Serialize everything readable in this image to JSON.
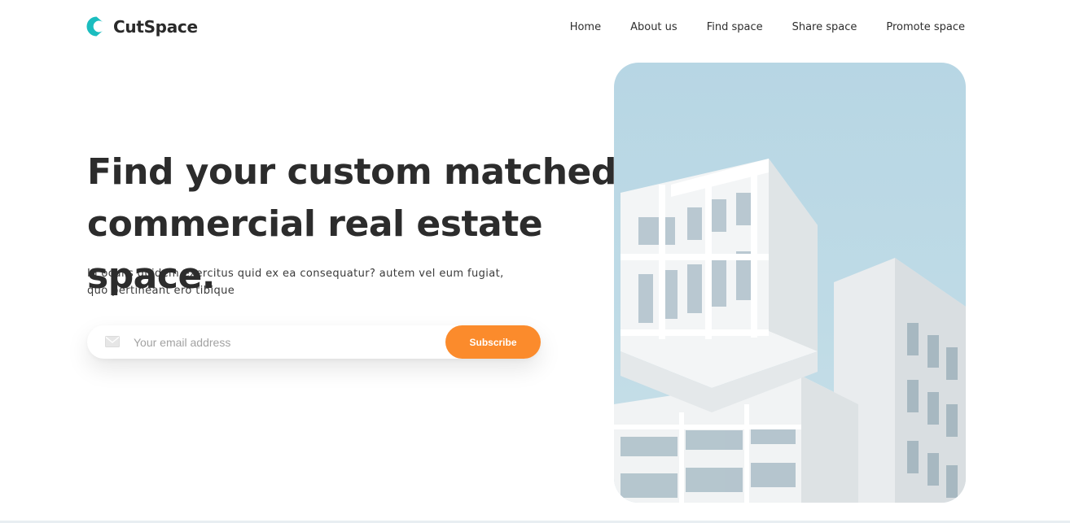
{
  "brand": {
    "name": "CutSpace",
    "logo_icon": "cut-circle-logo-icon",
    "logo_color": "#1bbdbf"
  },
  "nav": {
    "items": [
      {
        "label": "Home"
      },
      {
        "label": "About us"
      },
      {
        "label": "Find space"
      },
      {
        "label": "Share space"
      },
      {
        "label": "Promote space"
      }
    ]
  },
  "hero": {
    "headline_line1": "Find your custom matched",
    "headline_line2": "commercial real estate space.",
    "subtext_line1": "In oculis quidem exercitus quid ex ea consequatur? autem vel eum fugiat,",
    "subtext_line2": "quo pertineant ero tibique",
    "image_icon": "building-photo"
  },
  "subscribe": {
    "placeholder": "Your email address",
    "value": "",
    "button_label": "Subscribe",
    "button_color": "#fb8b2c",
    "input_icon": "mail-icon"
  }
}
